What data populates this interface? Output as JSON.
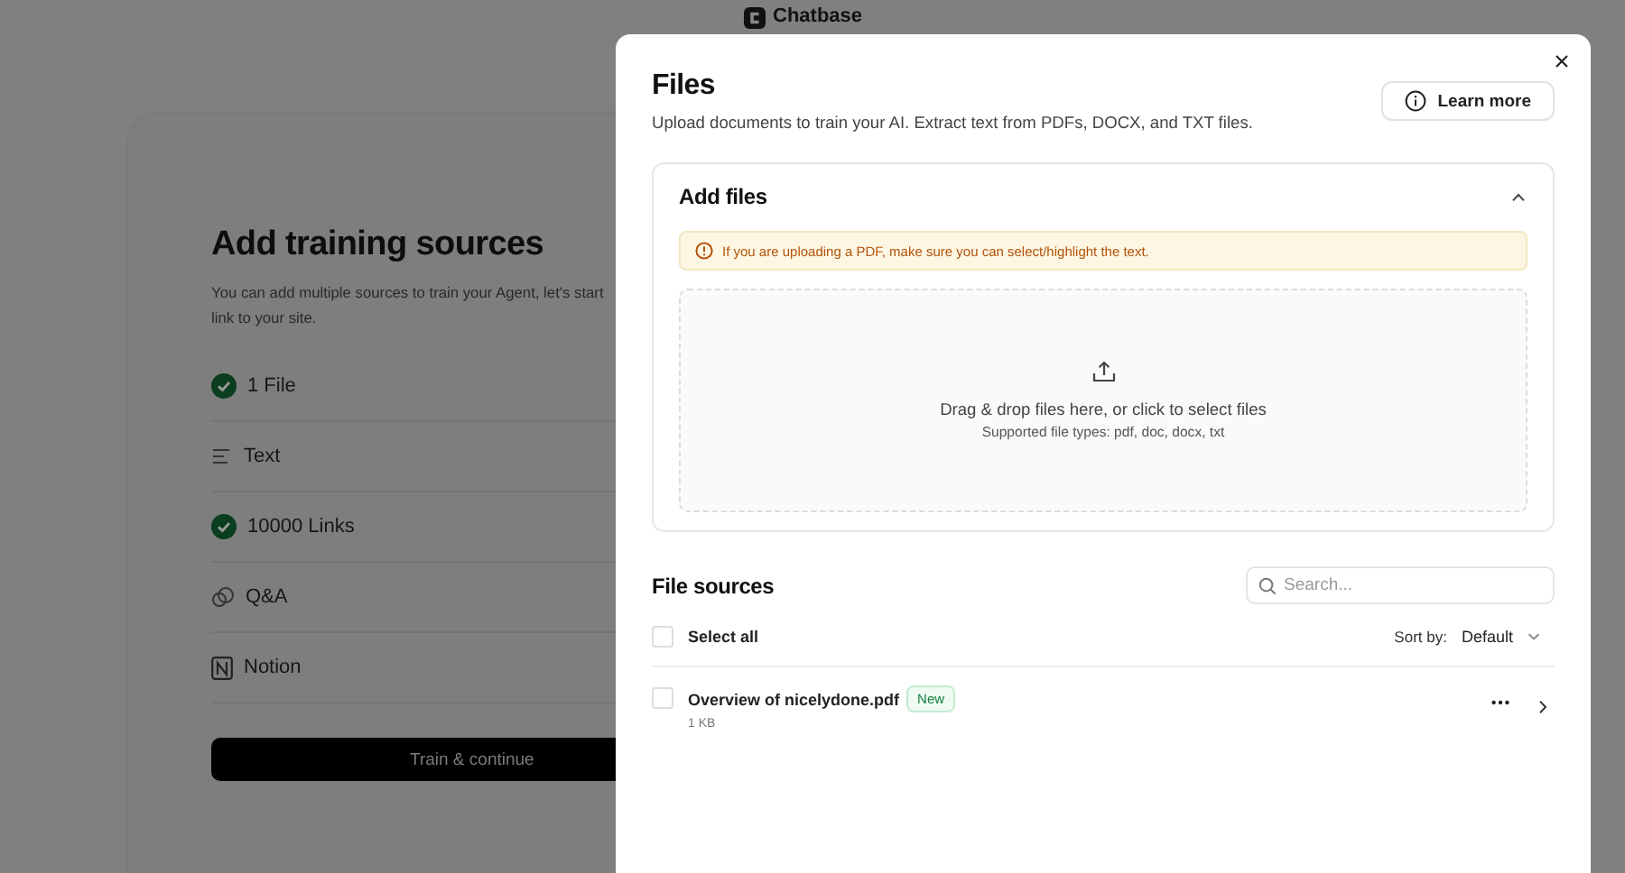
{
  "background": {
    "logo": "Chatbase",
    "title": "Add training sources",
    "description_lines": [
      "You can add multiple sources to train your Agent, let's start",
      "link to your site."
    ],
    "sources": [
      {
        "kind": "done",
        "label": "1 File"
      },
      {
        "kind": "text",
        "label": "Text"
      },
      {
        "kind": "done",
        "label": "10000 Links"
      },
      {
        "kind": "qa",
        "label": "Q&A"
      },
      {
        "kind": "notion",
        "label": "Notion"
      }
    ],
    "button": "Train & continue"
  },
  "modal": {
    "title": "Files",
    "subtitle": "Upload documents to train your AI. Extract text from PDFs, DOCX, and TXT files.",
    "learn_more": "Learn more",
    "add_files": {
      "title": "Add files",
      "expanded": true,
      "warning": "If you are uploading a PDF, make sure you can select/highlight the text.",
      "drop_title": "Drag & drop files here, or click to select files",
      "drop_hint": "Supported file types: pdf, doc, docx, txt"
    },
    "file_sources": {
      "title": "File sources",
      "search_placeholder": "Search...",
      "select_all": {
        "label": "Select all",
        "checked": false
      },
      "sort_label": "Sort by:",
      "sort_value": "Default",
      "files": [
        {
          "name": "Overview of nicelydone.pdf",
          "badge": "New",
          "size": "1 KB",
          "checked": false
        }
      ]
    }
  }
}
